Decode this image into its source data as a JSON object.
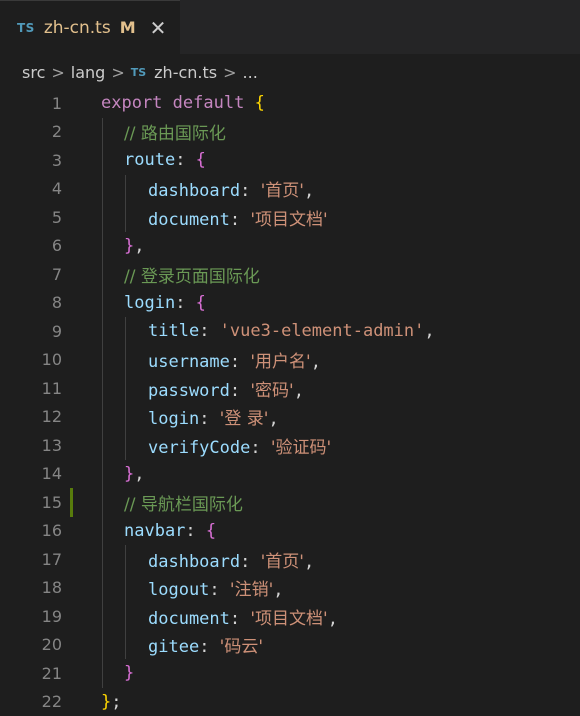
{
  "tab": {
    "lang_badge": "TS",
    "file_name": "zh-cn.ts",
    "modified_flag": "M",
    "close_glyph": "✕"
  },
  "breadcrumb": {
    "items": [
      "src",
      "lang",
      "zh-cn.ts",
      "..."
    ],
    "ts_badge": "TS",
    "separator": ">"
  },
  "colors": {
    "keyword": "#c586c0",
    "property": "#9cdcfe",
    "string": "#ce9178",
    "comment": "#6a9955",
    "bracket_outer": "#ffd700",
    "bracket_inner": "#da70d6",
    "modified_gutter": "#587c0c"
  },
  "code": {
    "line_numbers": [
      "1",
      "2",
      "3",
      "4",
      "5",
      "6",
      "7",
      "8",
      "9",
      "10",
      "11",
      "12",
      "13",
      "14",
      "15",
      "16",
      "17",
      "18",
      "19",
      "20",
      "21",
      "22"
    ],
    "kw_export": "export",
    "kw_default": "default",
    "comment_route": "// 路由国际化",
    "route_key": "route",
    "route_dashboard_key": "dashboard",
    "route_dashboard_val": "'首页'",
    "route_document_key": "document",
    "route_document_val": "'项目文档'",
    "comment_login": "// 登录页面国际化",
    "login_key": "login",
    "login_title_key": "title",
    "login_title_val": "'vue3-element-admin'",
    "login_username_key": "username",
    "login_username_val": "'用户名'",
    "login_password_key": "password",
    "login_password_val": "'密码'",
    "login_login_key": "login",
    "login_login_val": "'登 录'",
    "login_verify_key": "verifyCode",
    "login_verify_val": "'验证码'",
    "comment_navbar": "// 导航栏国际化",
    "navbar_key": "navbar",
    "navbar_dashboard_key": "dashboard",
    "navbar_dashboard_val": "'首页'",
    "navbar_logout_key": "logout",
    "navbar_logout_val": "'注销'",
    "navbar_document_key": "document",
    "navbar_document_val": "'项目文档'",
    "navbar_gitee_key": "gitee",
    "navbar_gitee_val": "'码云'",
    "modified_line": "15"
  }
}
